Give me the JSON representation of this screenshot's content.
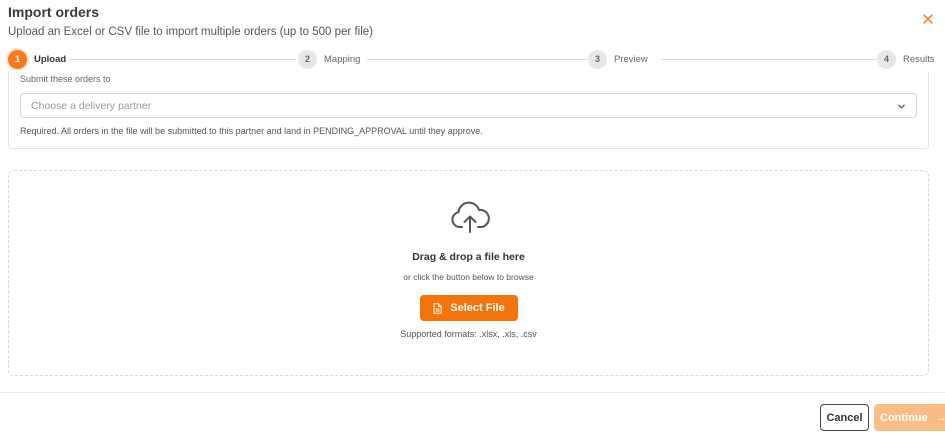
{
  "dialog": {
    "title": "Import orders",
    "subtitle": "Upload an Excel or CSV file to import multiple orders (up to 500 per file)",
    "close_icon": "close-icon",
    "accent_color": "#f57a1f"
  },
  "stepper": {
    "steps": [
      {
        "number": "1",
        "label": "Upload",
        "active": true
      },
      {
        "number": "2",
        "label": "Mapping",
        "active": false
      },
      {
        "number": "3",
        "label": "Preview",
        "active": false
      },
      {
        "number": "4",
        "label": "Results",
        "active": false
      }
    ]
  },
  "partner": {
    "label": "Submit these orders to",
    "placeholder": "Choose a delivery partner",
    "help": "Required. All orders in the file will be submitted to this partner and land in PENDING_APPROVAL until they approve."
  },
  "dropzone": {
    "icon": "cloud-upload-icon",
    "title": "Drag & drop a file here",
    "subtitle": "or click the button below to browse",
    "button_label": "Select File",
    "formats": "Supported formats: .xlsx, .xls, .csv"
  },
  "footer": {
    "cancel_label": "Cancel",
    "continue_label": "Continue",
    "continue_color": "#fbbd86"
  }
}
